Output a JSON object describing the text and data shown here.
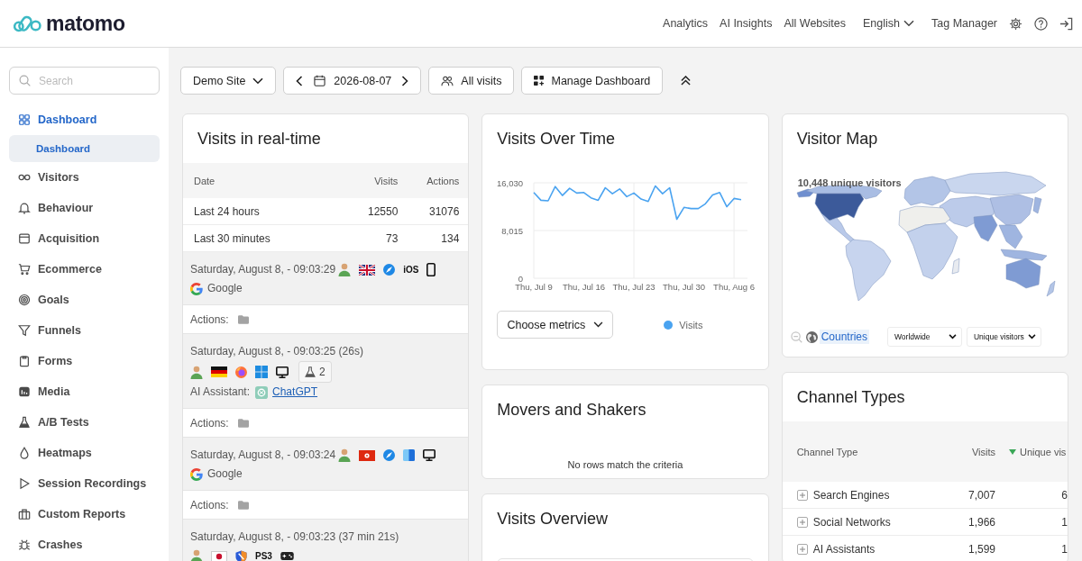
{
  "header": {
    "logo": "matomo",
    "nav": [
      {
        "label": "Analytics",
        "kind": "link"
      },
      {
        "label": "AI Insights",
        "kind": "link"
      },
      {
        "label": "All Websites",
        "kind": "link"
      },
      {
        "label": "English",
        "kind": "dropdown"
      },
      {
        "label": "Tag Manager",
        "kind": "link"
      }
    ]
  },
  "sidebar": {
    "search": {
      "placeholder": "Search"
    },
    "items": [
      {
        "label": "Dashboard",
        "selected": true,
        "children": [
          {
            "label": "Dashboard",
            "selected": true
          }
        ]
      },
      {
        "label": "Visitors",
        "selected": false
      },
      {
        "label": "Behaviour",
        "selected": false
      },
      {
        "label": "Acquisition",
        "selected": false
      },
      {
        "label": "Ecommerce",
        "selected": false
      },
      {
        "label": "Goals",
        "selected": false
      },
      {
        "label": "Funnels",
        "selected": false
      },
      {
        "label": "Forms",
        "selected": false
      },
      {
        "label": "Media",
        "selected": false
      },
      {
        "label": "A/B Tests",
        "selected": false
      },
      {
        "label": "Heatmaps",
        "selected": false
      },
      {
        "label": "Session Recordings",
        "selected": false
      },
      {
        "label": "Custom Reports",
        "selected": false
      },
      {
        "label": "Crashes",
        "selected": false
      }
    ]
  },
  "toolbar": {
    "site": "Demo Site",
    "date": "2026-08-07",
    "segment": "All visits",
    "manage": "Manage Dashboard"
  },
  "realtime": {
    "title": "Visits in real-time",
    "columns": [
      "Date",
      "Visits",
      "Actions"
    ],
    "rows": [
      [
        "Last 24 hours",
        "12550",
        "31076"
      ],
      [
        "Last 30 minutes",
        "73",
        "134"
      ]
    ],
    "visits": [
      {
        "time": "Saturday, August 8, - 09:03:29",
        "icons": [
          {
            "kind": "profile"
          },
          {
            "kind": "uk"
          },
          {
            "kind": "safari"
          },
          {
            "kind": "label",
            "text": "iOS"
          },
          {
            "kind": "smartphone"
          }
        ],
        "source": {
          "kind": "search",
          "name": "Google"
        },
        "actions": "Actions:"
      },
      {
        "time": "Saturday, August 8, - 09:03:25 (26s)",
        "icons": [
          {
            "kind": "profile"
          },
          {
            "kind": "germany"
          },
          {
            "kind": "firefox"
          },
          {
            "kind": "windows"
          },
          {
            "kind": "desktop"
          },
          {
            "kind": "abtest",
            "text": "2"
          }
        ],
        "source": {
          "kind": "ai",
          "label": "AI Assistant:",
          "name": "ChatGPT"
        },
        "actions": "Actions:"
      },
      {
        "time": "Saturday, August 8, - 09:03:24",
        "icons": [
          {
            "kind": "profile"
          },
          {
            "kind": "hongkong"
          },
          {
            "kind": "safari"
          },
          {
            "kind": "macos"
          },
          {
            "kind": "desktop"
          }
        ],
        "source": {
          "kind": "search",
          "name": "Google"
        },
        "actions": "Actions:"
      },
      {
        "time": "Saturday, August 8, - 09:03:23 (37 min 21s)",
        "icons": [
          {
            "kind": "profile"
          },
          {
            "kind": "japan"
          },
          {
            "kind": "shield"
          },
          {
            "kind": "label",
            "text": "PS3"
          },
          {
            "kind": "console"
          }
        ]
      }
    ]
  },
  "visits_over_time": {
    "title": "Visits Over Time",
    "chart_data": {
      "type": "line",
      "categories": [
        "Thu, Jul 9",
        null,
        null,
        null,
        null,
        null,
        null,
        "Thu, Jul 16",
        null,
        null,
        null,
        null,
        null,
        null,
        "Thu, Jul 23",
        null,
        null,
        null,
        null,
        null,
        null,
        "Thu, Jul 30",
        null,
        null,
        null,
        null,
        null,
        null,
        "Thu, Aug 6",
        null
      ],
      "ylim": [
        0,
        16030
      ],
      "yticks": [
        0,
        {
          "value": 8015,
          "label": "8,015"
        },
        {
          "value": 16030,
          "label": "16,030"
        }
      ],
      "grid": true,
      "series": [
        {
          "name": "Visits",
          "color": "#4aa3f0",
          "values": [
            14400,
            13100,
            13000,
            15400,
            13900,
            15100,
            14300,
            14400,
            13500,
            13100,
            15200,
            14200,
            15000,
            13700,
            14300,
            13300,
            12900,
            15500,
            14200,
            15200,
            9900,
            11900,
            11700,
            11700,
            12500,
            14000,
            14400,
            12000,
            13400,
            13200
          ]
        }
      ]
    },
    "metrics_button": "Choose metrics"
  },
  "movers": {
    "title": "Movers and Shakers",
    "message": "No rows match the criteria"
  },
  "overview": {
    "title": "Visits Overview"
  },
  "visitor_map": {
    "title": "Visitor Map",
    "summary": "10,448 unique visitors",
    "level_link": "Countries",
    "region": "Worldwide",
    "metric": "Unique visitors"
  },
  "channel_types": {
    "title": "Channel Types",
    "columns": [
      {
        "label": "Channel Type",
        "sorted": false
      },
      {
        "label": "Visits",
        "sorted": false
      },
      {
        "label": "Unique vis",
        "sorted": true
      }
    ],
    "rows": [
      [
        "Search Engines",
        "7,007",
        "6"
      ],
      [
        "Social Networks",
        "1,966",
        "1"
      ],
      [
        "AI Assistants",
        "1,599",
        "1"
      ]
    ]
  }
}
